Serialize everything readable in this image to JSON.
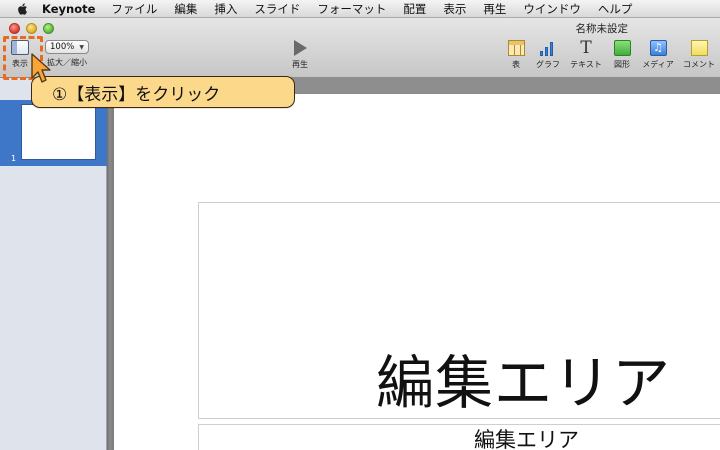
{
  "menubar": {
    "app_name": "Keynote",
    "items": [
      "ファイル",
      "編集",
      "挿入",
      "スライド",
      "フォーマット",
      "配置",
      "表示",
      "再生",
      "ウインドウ",
      "ヘルプ"
    ]
  },
  "window": {
    "title": "名称未設定"
  },
  "toolbar": {
    "view_label": "表示",
    "zoom_value": "100%",
    "zoom_label": "拡大／縮小",
    "play_label": "再生",
    "table_label": "表",
    "chart_label": "グラフ",
    "text_label": "テキスト",
    "text_glyph": "T",
    "shape_label": "図形",
    "media_label": "メディア",
    "media_glyph": "♫",
    "comment_label": "コメント"
  },
  "callout": {
    "text": "①【表示】をクリック"
  },
  "sidebar": {
    "slides": [
      {
        "number": "1"
      }
    ]
  },
  "slide": {
    "title_text": "編集エリア",
    "subtitle_text": "編集エリア"
  },
  "colors": {
    "highlight": "#ea6a20",
    "callout_bg": "#fcd98a",
    "selection": "#3f77c8"
  },
  "icons": [
    "apple-icon",
    "view-icon",
    "play-icon",
    "table-icon",
    "chart-icon",
    "text-icon",
    "shape-icon",
    "media-icon",
    "comment-icon",
    "cursor-pointer-icon"
  ]
}
